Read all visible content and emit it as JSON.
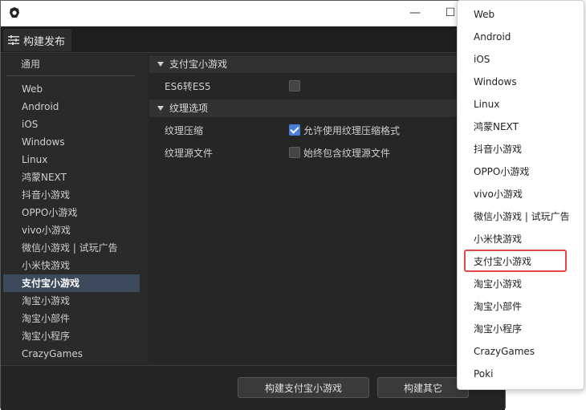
{
  "window": {
    "tab_label": "构建发布",
    "controls": {
      "minimize": "—",
      "maximize": "☐"
    }
  },
  "sidebar": {
    "general_label": "通用",
    "items": [
      {
        "label": "Web"
      },
      {
        "label": "Android"
      },
      {
        "label": "iOS"
      },
      {
        "label": "Windows"
      },
      {
        "label": "Linux"
      },
      {
        "label": "鸿蒙NEXT"
      },
      {
        "label": "抖音小游戏"
      },
      {
        "label": "OPPO小游戏"
      },
      {
        "label": "vivo小游戏"
      },
      {
        "label": "微信小游戏 | 试玩广告"
      },
      {
        "label": "小米快游戏"
      },
      {
        "label": "支付宝小游戏",
        "active": true
      },
      {
        "label": "淘宝小游戏"
      },
      {
        "label": "淘宝小部件"
      },
      {
        "label": "淘宝小程序"
      },
      {
        "label": "CrazyGames"
      }
    ]
  },
  "main": {
    "section1": {
      "title": "支付宝小游戏",
      "es6_label": "ES6转ES5",
      "es6_checked": false
    },
    "section2": {
      "title": "纹理选项",
      "compress_label": "纹理压缩",
      "compress_checkbox_text": "允许使用纹理压缩格式",
      "compress_checked": true,
      "source_label": "纹理源文件",
      "source_checkbox_text": "始终包含纹理源文件",
      "source_checked": false
    }
  },
  "footer": {
    "build_button": "构建支付宝小游戏",
    "build_other_button": "构建其它"
  },
  "dropdown": {
    "items": [
      "Web",
      "Android",
      "iOS",
      "Windows",
      "Linux",
      "鸿蒙NEXT",
      "抖音小游戏",
      "OPPO小游戏",
      "vivo小游戏",
      "微信小游戏 | 试玩广告",
      "小米快游戏",
      "支付宝小游戏",
      "淘宝小游戏",
      "淘宝小部件",
      "淘宝小程序",
      "CrazyGames",
      "Poki"
    ],
    "highlighted": "支付宝小游戏",
    "highlight_color": "#e0484a"
  }
}
